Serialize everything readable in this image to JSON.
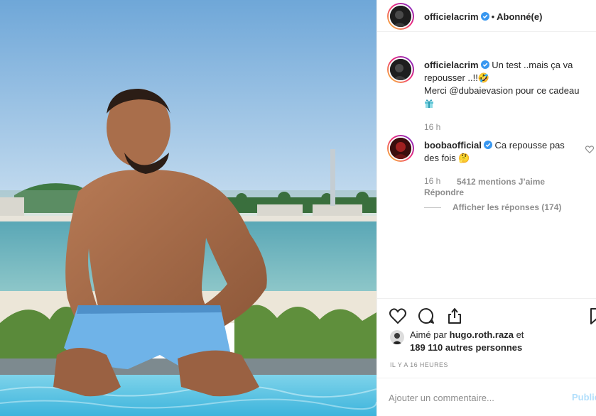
{
  "post": {
    "author": "officielacrim",
    "follow_status": "Abonné(e)",
    "separator": "•"
  },
  "caption": {
    "username": "officielacrim",
    "text_line1": "Un test ..mais ça va repousser ..!!🤣",
    "text_line2": "Merci @dubaievasion pour ce cadeau",
    "time": "16 h"
  },
  "comments": [
    {
      "username": "boobaofficial",
      "text": "Ca repousse pas des fois 🤔",
      "time": "16 h",
      "likes": "5412 mentions J’aime",
      "reply": "Répondre",
      "show_replies": "Afficher les réponses (174)"
    }
  ],
  "likes": {
    "prefix": "Aimé par",
    "user": "hugo.roth.raza",
    "suffix": "et",
    "others": "189 110 autres personnes"
  },
  "timestamp": "IL Y A 16 HEURES",
  "add_comment": {
    "placeholder": "Ajouter un commentaire...",
    "publish": "Publier"
  },
  "icons": {
    "verified": "verified-badge-icon",
    "like": "heart-icon",
    "comment": "comment-bubble-icon",
    "share": "share-icon",
    "save": "bookmark-icon",
    "gift": "gift-icon"
  },
  "colors": {
    "verified": "#3897f0",
    "text": "#262626",
    "muted": "#8e8e8e",
    "publish_disabled": "#b2dffc"
  }
}
